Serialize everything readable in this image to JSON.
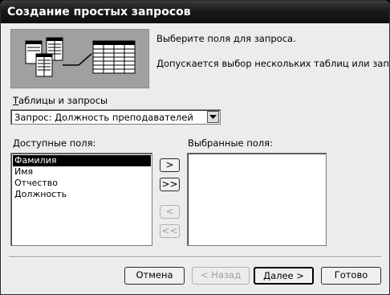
{
  "window": {
    "title": "Создание простых запросов"
  },
  "info": {
    "line1": "Выберите поля для запроса.",
    "line2": "Допускается выбор нескольких таблиц или запросов."
  },
  "tables": {
    "label_accel": "Т",
    "label_rest": "аблицы и запросы",
    "selected": "Запрос: Должность преподавателей"
  },
  "available": {
    "label_accel": "Д",
    "label_rest": "оступные поля:",
    "items": [
      "Фамилия",
      "Имя",
      "Отчество",
      "Должность"
    ],
    "selected_index": 0
  },
  "selected_fields": {
    "label": "Выбранные поля:",
    "items": []
  },
  "move_buttons": {
    "add_one": ">",
    "add_all": ">>",
    "remove_one": "<",
    "remove_all": "<<"
  },
  "footer": {
    "cancel": "Отмена",
    "back": "< Назад",
    "next": "Далее >",
    "finish": "Готово"
  },
  "colors": {
    "titlebar": "#1a1a1a",
    "dialog_bg": "#ececec",
    "selection_bg": "#000000",
    "disabled_text": "#a0a0a0"
  }
}
